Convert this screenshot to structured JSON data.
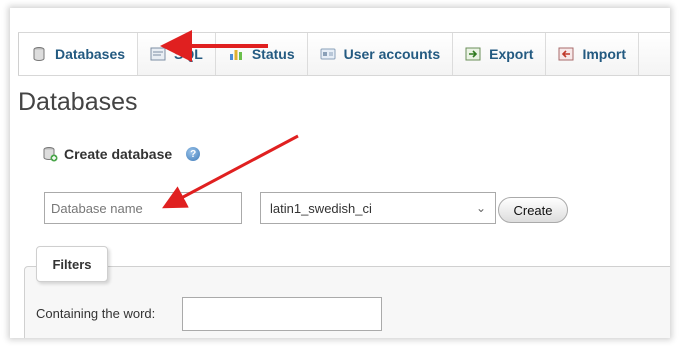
{
  "tabs": [
    {
      "label": "Databases",
      "icon": "database-icon",
      "active": true
    },
    {
      "label": "SQL",
      "icon": "sql-icon",
      "active": false
    },
    {
      "label": "Status",
      "icon": "status-icon",
      "active": false
    },
    {
      "label": "User accounts",
      "icon": "user-accounts-icon",
      "active": false
    },
    {
      "label": "Export",
      "icon": "export-icon",
      "active": false
    },
    {
      "label": "Import",
      "icon": "import-icon",
      "active": false
    }
  ],
  "page_title": "Databases",
  "create_section": {
    "label": "Create database",
    "name_placeholder": "Database name",
    "collation_value": "latin1_swedish_ci",
    "create_button": "Create"
  },
  "filters": {
    "legend": "Filters",
    "containing_label": "Containing the word:",
    "containing_value": ""
  },
  "colors": {
    "tab_text": "#235a81",
    "annotation_arrow": "#e02020"
  }
}
